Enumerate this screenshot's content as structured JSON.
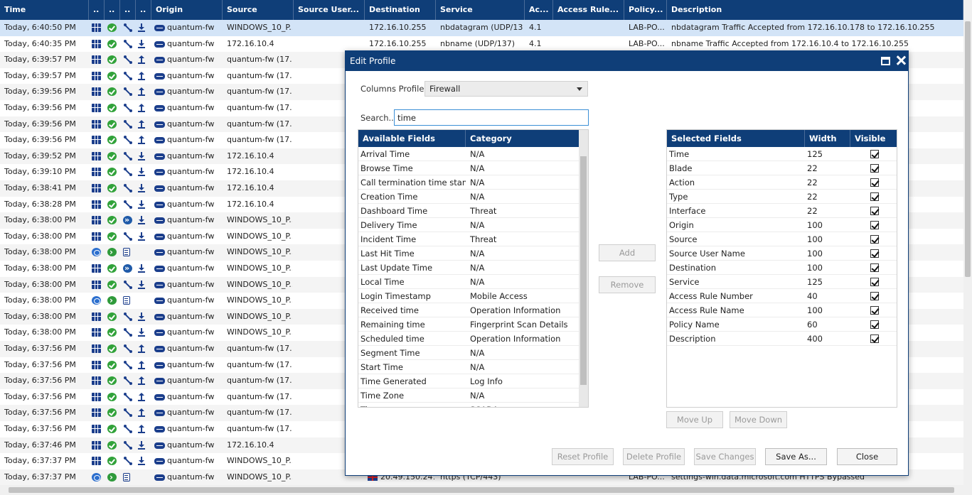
{
  "table": {
    "columns": [
      {
        "key": "time",
        "label": "Time",
        "w": 125
      },
      {
        "key": "blade",
        "label": "..",
        "w": 22
      },
      {
        "key": "action",
        "label": "..",
        "w": 22
      },
      {
        "key": "type",
        "label": "..",
        "w": 22
      },
      {
        "key": "iface",
        "label": "..",
        "w": 22
      },
      {
        "key": "origin",
        "label": "Origin",
        "w": 100
      },
      {
        "key": "source",
        "label": "Source",
        "w": 100
      },
      {
        "key": "user",
        "label": "Source User...",
        "w": 100
      },
      {
        "key": "dest",
        "label": "Destination",
        "w": 100
      },
      {
        "key": "service",
        "label": "Service",
        "w": 125
      },
      {
        "key": "rulenum",
        "label": "Ac...",
        "w": 40
      },
      {
        "key": "rulename",
        "label": "Access Rule...",
        "w": 100
      },
      {
        "key": "policy",
        "label": "Policy...",
        "w": 60
      },
      {
        "key": "desc",
        "label": "Description",
        "w": 417
      }
    ],
    "rows": [
      {
        "time": "Today, 6:40:50 PM",
        "blade": "fw",
        "action": "accept",
        "type": "conn",
        "dir": "in",
        "origin": "quantum-fw",
        "source": "WINDOWS_10_P...",
        "dest": "172.16.10.255",
        "service": "nbdatagram (UDP/13...",
        "rulenum": "4.1",
        "policy": "LAB-PO...",
        "desc": "nbdatagram Traffic Accepted from 172.16.10.178 to 172.16.10.255",
        "selected": true
      },
      {
        "time": "Today, 6:40:35 PM",
        "blade": "fw",
        "action": "accept",
        "type": "conn",
        "dir": "in",
        "origin": "quantum-fw",
        "source": "172.16.10.4",
        "dest": "172.16.10.255",
        "service": "nbname (UDP/137)",
        "rulenum": "4.1",
        "policy": "LAB-PO...",
        "desc": "nbname Traffic Accepted from 172.16.10.4 to 172.16.10.255"
      },
      {
        "time": "Today, 6:39:57 PM",
        "blade": "fw",
        "action": "accept",
        "type": "conn",
        "dir": "out",
        "origin": "quantum-fw",
        "source": "quantum-fw (17..."
      },
      {
        "time": "Today, 6:39:57 PM",
        "blade": "fw",
        "action": "accept",
        "type": "conn",
        "dir": "out",
        "origin": "quantum-fw",
        "source": "quantum-fw (17..."
      },
      {
        "time": "Today, 6:39:56 PM",
        "blade": "fw",
        "action": "accept",
        "type": "conn",
        "dir": "out",
        "origin": "quantum-fw",
        "source": "quantum-fw (17..."
      },
      {
        "time": "Today, 6:39:56 PM",
        "blade": "fw",
        "action": "accept",
        "type": "conn",
        "dir": "out",
        "origin": "quantum-fw",
        "source": "quantum-fw (17..."
      },
      {
        "time": "Today, 6:39:56 PM",
        "blade": "fw",
        "action": "accept",
        "type": "conn",
        "dir": "out",
        "origin": "quantum-fw",
        "source": "quantum-fw (17..."
      },
      {
        "time": "Today, 6:39:56 PM",
        "blade": "fw",
        "action": "accept",
        "type": "conn",
        "dir": "out",
        "origin": "quantum-fw",
        "source": "quantum-fw (17..."
      },
      {
        "time": "Today, 6:39:52 PM",
        "blade": "fw",
        "action": "accept",
        "type": "conn",
        "dir": "in",
        "origin": "quantum-fw",
        "source": "172.16.10.4"
      },
      {
        "time": "Today, 6:39:10 PM",
        "blade": "fw",
        "action": "accept",
        "type": "conn",
        "dir": "in",
        "origin": "quantum-fw",
        "source": "172.16.10.4"
      },
      {
        "time": "Today, 6:38:41 PM",
        "blade": "fw",
        "action": "accept",
        "type": "conn",
        "dir": "in",
        "origin": "quantum-fw",
        "source": "172.16.10.4"
      },
      {
        "time": "Today, 6:38:28 PM",
        "blade": "fw",
        "action": "accept",
        "type": "conn",
        "dir": "in",
        "origin": "quantum-fw",
        "source": "172.16.10.4"
      },
      {
        "time": "Today, 6:38:00 PM",
        "blade": "fw",
        "action": "accept",
        "type": "bypass",
        "dir": "in",
        "origin": "quantum-fw",
        "source": "WINDOWS_10_P..."
      },
      {
        "time": "Today, 6:38:00 PM",
        "blade": "fw",
        "action": "accept",
        "type": "conn",
        "dir": "in",
        "origin": "quantum-fw",
        "source": "WINDOWS_10_P..."
      },
      {
        "time": "Today, 6:38:00 PM",
        "blade": "urlf",
        "action": "inspect",
        "type": "log",
        "dir": "none",
        "origin": "quantum-fw",
        "source": "WINDOWS_10_P..."
      },
      {
        "time": "Today, 6:38:00 PM",
        "blade": "fw",
        "action": "accept",
        "type": "bypass",
        "dir": "in",
        "origin": "quantum-fw",
        "source": "WINDOWS_10_P..."
      },
      {
        "time": "Today, 6:38:00 PM",
        "blade": "fw",
        "action": "accept",
        "type": "conn",
        "dir": "in",
        "origin": "quantum-fw",
        "source": "WINDOWS_10_P..."
      },
      {
        "time": "Today, 6:38:00 PM",
        "blade": "urlf",
        "action": "inspect",
        "type": "log",
        "dir": "none",
        "origin": "quantum-fw",
        "source": "WINDOWS_10_P..."
      },
      {
        "time": "Today, 6:38:00 PM",
        "blade": "fw",
        "action": "accept",
        "type": "conn",
        "dir": "in",
        "origin": "quantum-fw",
        "source": "WINDOWS_10_P..."
      },
      {
        "time": "Today, 6:38:00 PM",
        "blade": "fw",
        "action": "accept",
        "type": "conn",
        "dir": "in",
        "origin": "quantum-fw",
        "source": "WINDOWS_10_P..."
      },
      {
        "time": "Today, 6:37:56 PM",
        "blade": "fw",
        "action": "accept",
        "type": "conn",
        "dir": "out",
        "origin": "quantum-fw",
        "source": "quantum-fw (17..."
      },
      {
        "time": "Today, 6:37:56 PM",
        "blade": "fw",
        "action": "accept",
        "type": "conn",
        "dir": "out",
        "origin": "quantum-fw",
        "source": "quantum-fw (17..."
      },
      {
        "time": "Today, 6:37:56 PM",
        "blade": "fw",
        "action": "accept",
        "type": "conn",
        "dir": "out",
        "origin": "quantum-fw",
        "source": "quantum-fw (17..."
      },
      {
        "time": "Today, 6:37:56 PM",
        "blade": "fw",
        "action": "accept",
        "type": "conn",
        "dir": "out",
        "origin": "quantum-fw",
        "source": "quantum-fw (17..."
      },
      {
        "time": "Today, 6:37:56 PM",
        "blade": "fw",
        "action": "accept",
        "type": "conn",
        "dir": "out",
        "origin": "quantum-fw",
        "source": "quantum-fw (17..."
      },
      {
        "time": "Today, 6:37:56 PM",
        "blade": "fw",
        "action": "accept",
        "type": "conn",
        "dir": "out",
        "origin": "quantum-fw",
        "source": "quantum-fw (17..."
      },
      {
        "time": "Today, 6:37:46 PM",
        "blade": "fw",
        "action": "accept",
        "type": "conn",
        "dir": "in",
        "origin": "quantum-fw",
        "source": "172.16.10.4"
      },
      {
        "time": "Today, 6:37:37 PM",
        "blade": "fw",
        "action": "accept",
        "type": "conn",
        "dir": "in",
        "origin": "quantum-fw",
        "source": "WINDOWS_10_P..."
      },
      {
        "time": "Today, 6:37:37 PM",
        "blade": "urlf",
        "action": "inspect",
        "type": "log",
        "dir": "none",
        "origin": "quantum-fw",
        "source": "WINDOWS_10_P...",
        "dest": "20.49.150.241",
        "destFlag": true,
        "service": "https (TCP/443)",
        "policy": "LAB-PO...",
        "desc": "settings-win.data.microsoft.com HTTPS Bypassed"
      }
    ]
  },
  "dialog": {
    "title": "Edit Profile",
    "columns_profile_label": "Columns Profile:",
    "columns_profile_value": "Firewall",
    "search_label": "Search...",
    "search_value": "time",
    "available": {
      "headers": [
        "Available Fields",
        "Category"
      ],
      "rows": [
        [
          "Arrival Time",
          "N/A"
        ],
        [
          "Browse Time",
          "N/A"
        ],
        [
          "Call termination time stamp",
          "N/A"
        ],
        [
          "Creation Time",
          "N/A"
        ],
        [
          "Dashboard Time",
          "Threat"
        ],
        [
          "Delivery Time",
          "N/A"
        ],
        [
          "Incident Time",
          "Threat"
        ],
        [
          "Last Hit Time",
          "N/A"
        ],
        [
          "Last Update Time",
          "N/A"
        ],
        [
          "Local Time",
          "N/A"
        ],
        [
          "Login Timestamp",
          "Mobile Access"
        ],
        [
          "Received time",
          "Operation Information"
        ],
        [
          "Remaining time",
          "Fingerprint Scan Details"
        ],
        [
          "Scheduled time",
          "Operation Information"
        ],
        [
          "Segment Time",
          "N/A"
        ],
        [
          "Start Time",
          "N/A"
        ],
        [
          "Time Generated",
          "Log Info"
        ],
        [
          "Time Zone",
          "N/A"
        ],
        [
          "Time...",
          "SCADA"
        ]
      ]
    },
    "add_label": "Add",
    "remove_label": "Remove",
    "selected": {
      "headers": [
        "Selected Fields",
        "Width",
        "Visible"
      ],
      "rows": [
        [
          "Time",
          "125"
        ],
        [
          "Blade",
          "22"
        ],
        [
          "Action",
          "22"
        ],
        [
          "Type",
          "22"
        ],
        [
          "Interface",
          "22"
        ],
        [
          "Origin",
          "100"
        ],
        [
          "Source",
          "100"
        ],
        [
          "Source User Name",
          "100"
        ],
        [
          "Destination",
          "100"
        ],
        [
          "Service",
          "125"
        ],
        [
          "Access Rule Number",
          "40"
        ],
        [
          "Access Rule Name",
          "100"
        ],
        [
          "Policy Name",
          "60"
        ],
        [
          "Description",
          "400"
        ]
      ]
    },
    "move_up_label": "Move Up",
    "move_down_label": "Move Down",
    "buttons": {
      "reset": "Reset Profile",
      "delete": "Delete Profile",
      "save_changes": "Save Changes",
      "save_as": "Save As...",
      "close": "Close"
    }
  },
  "colors": {
    "header": "#0f3e78",
    "selected_row": "#d3e4f7",
    "accent": "#3b8fd6"
  }
}
